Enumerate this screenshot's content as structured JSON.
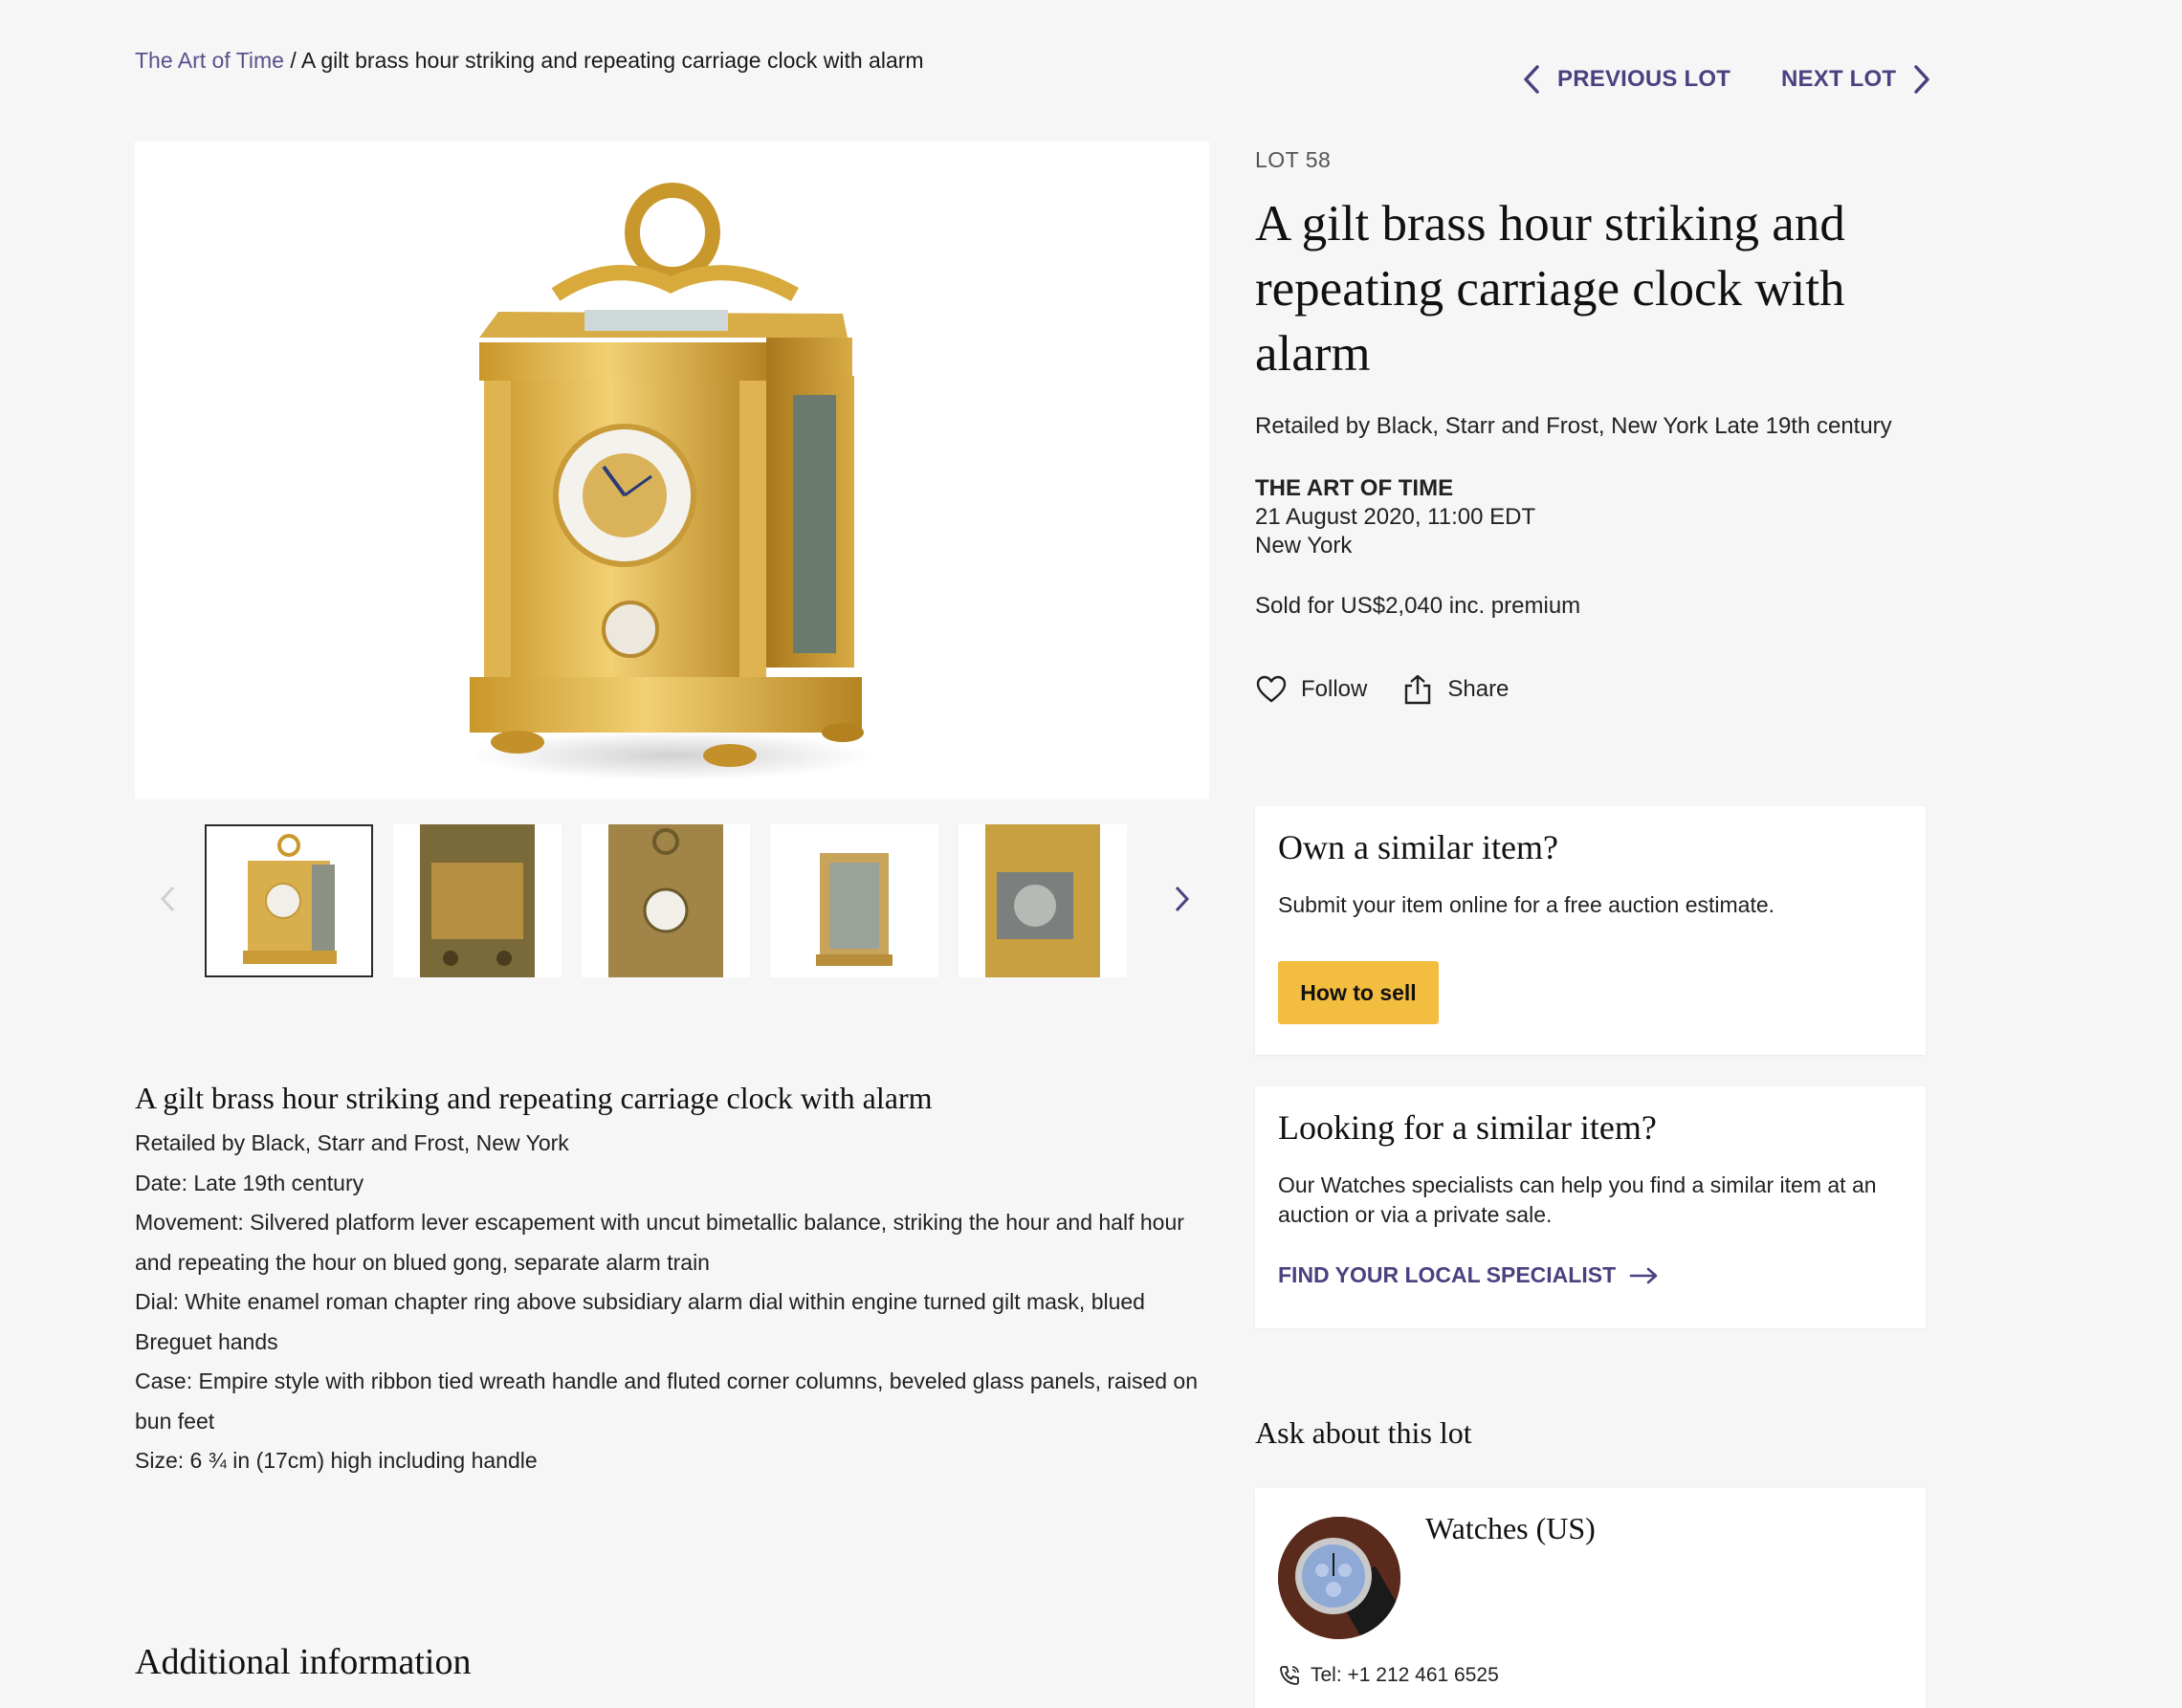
{
  "breadcrumb": {
    "parent": "The Art of Time",
    "separator": " / ",
    "current": "A gilt brass hour striking and repeating carriage clock with alarm"
  },
  "lot_nav": {
    "previous_label": "PREVIOUS LOT",
    "next_label": "NEXT LOT",
    "previous_icon": "chevron-left-icon",
    "next_icon": "chevron-right-icon"
  },
  "lot": {
    "number_label": "LOT 58",
    "title": "A gilt brass hour striking and repeating carriage clock with alarm",
    "subtitle": "Retailed by Black, Starr and Frost, New York Late 19th century",
    "sale_name": "THE ART OF TIME",
    "sale_date": "21 August 2020, 11:00 EDT",
    "sale_location": "New York",
    "sold_text": "Sold for US$2,040 inc. premium"
  },
  "actions": {
    "follow_label": "Follow",
    "share_label": "Share",
    "follow_icon": "heart-icon",
    "share_icon": "share-icon"
  },
  "gallery": {
    "thumbnail_count": 5,
    "active_index": 0
  },
  "sell_card": {
    "heading": "Own a similar item?",
    "text": "Submit your item online for a free auction estimate.",
    "button_label": "How to sell"
  },
  "specialist_card": {
    "heading": "Looking for a similar item?",
    "text": "Our Watches specialists can help you find a similar item at an auction or via a private sale.",
    "link_label": "FIND YOUR LOCAL SPECIALIST"
  },
  "ask": {
    "heading": "Ask about this lot",
    "department": "Watches (US)",
    "tel": "Tel: +1 212 461 6525"
  },
  "description": {
    "heading": "A gilt brass hour striking and repeating carriage clock with alarm",
    "lines": [
      "Retailed by Black, Starr and Frost, New York",
      "Date: Late 19th century",
      "Movement: Silvered platform lever escapement with uncut bimetallic balance, striking the hour and half hour and repeating the hour on blued gong, separate alarm train",
      "Dial: White enamel roman chapter ring above subsidiary alarm dial within engine turned gilt mask, blued Breguet hands",
      "Case: Empire style with ribbon tied wreath handle and fluted corner columns, beveled glass panels, raised on bun feet",
      "Size: 6 ¾ in (17cm) high including handle"
    ]
  },
  "additional_info_heading": "Additional information",
  "colors": {
    "accent_purple": "#4b4180",
    "link_purple": "#5a4f8c",
    "button_yellow": "#f3bd3f",
    "background": "#f6f6f6"
  }
}
